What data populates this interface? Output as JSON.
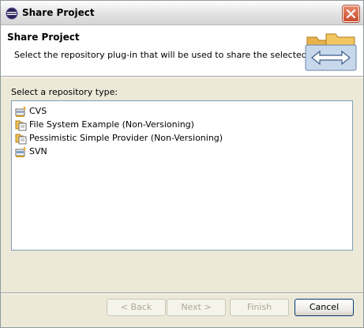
{
  "window": {
    "title": "Share Project"
  },
  "header": {
    "title": "Share Project",
    "description": "Select the repository plug-in that will be used to share the selected project."
  },
  "list": {
    "label": "Select a repository type:",
    "items": [
      {
        "label": "CVS",
        "icon": "cvs-icon"
      },
      {
        "label": "File System Example (Non-Versioning)",
        "icon": "file-system-icon"
      },
      {
        "label": "Pessimistic Simple Provider (Non-Versioning)",
        "icon": "file-system-icon"
      },
      {
        "label": "SVN",
        "icon": "svn-icon"
      }
    ]
  },
  "buttons": {
    "back": "< Back",
    "next": "Next >",
    "finish": "Finish",
    "cancel": "Cancel"
  },
  "colors": {
    "list_border": "#7f9db9",
    "dialog_bg": "#ece9d8",
    "close_red": "#c94a2a"
  }
}
